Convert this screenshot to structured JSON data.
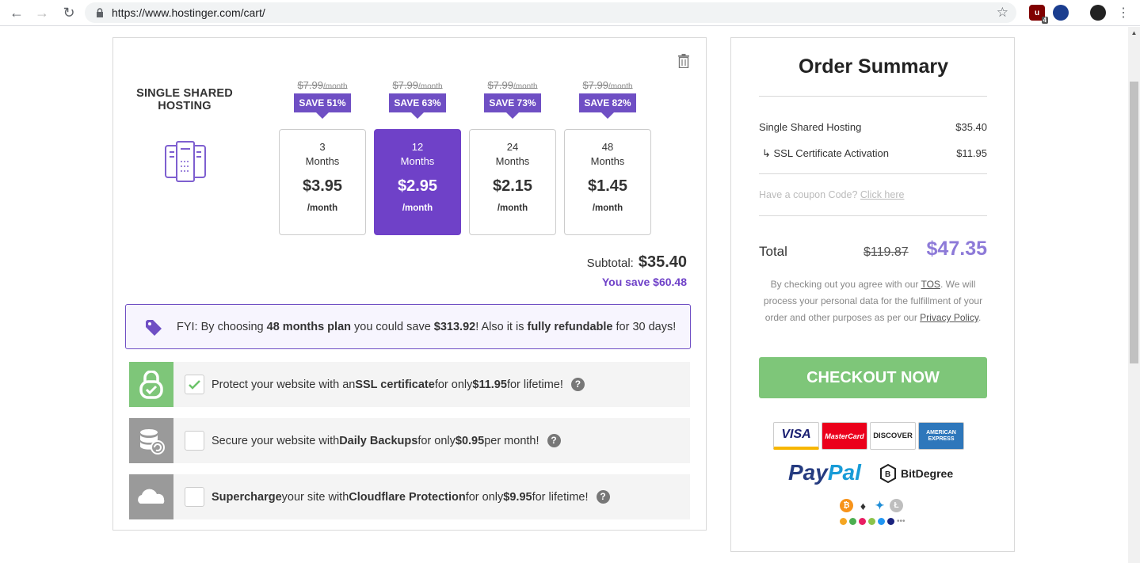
{
  "browser": {
    "url": "https://www.hostinger.com/cart/",
    "ext_badge": "4"
  },
  "product": {
    "title": "SINGLE SHARED HOSTING"
  },
  "plans": [
    {
      "old_price": "$7.99",
      "old_unit": "/month",
      "badge": "SAVE 51%",
      "months_num": "3",
      "months_label": "Months",
      "price": "$3.95",
      "per": "/month",
      "selected": false
    },
    {
      "old_price": "$7.99",
      "old_unit": "/month",
      "badge": "SAVE 63%",
      "months_num": "12",
      "months_label": "Months",
      "price": "$2.95",
      "per": "/month",
      "selected": true
    },
    {
      "old_price": "$7.99",
      "old_unit": "/month",
      "badge": "SAVE 73%",
      "months_num": "24",
      "months_label": "Months",
      "price": "$2.15",
      "per": "/month",
      "selected": false
    },
    {
      "old_price": "$7.99",
      "old_unit": "/month",
      "badge": "SAVE 82%",
      "months_num": "48",
      "months_label": "Months",
      "price": "$1.45",
      "per": "/month",
      "selected": false
    }
  ],
  "subtotal": {
    "label": "Subtotal:",
    "value": "$35.40",
    "you_save": "You save $60.48"
  },
  "fyi": {
    "prefix": "FYI: By choosing ",
    "plan": "48 months plan",
    "mid": " you could save ",
    "amount": "$313.92",
    "mid2": "! Also it is ",
    "refundable": "fully refundable",
    "suffix": " for 30 days!"
  },
  "addons": [
    {
      "checked": true,
      "pre": "Protect your website with an ",
      "bold1": "SSL certificate",
      "mid": " for only ",
      "bold2": "$11.95",
      "post": " for lifetime!",
      "side_color": "#7ec679"
    },
    {
      "checked": false,
      "pre": "Secure your website with ",
      "bold1": "Daily Backups",
      "mid": " for only ",
      "bold2": "$0.95",
      "post": " per month!",
      "side_color": "#9a9a9a"
    },
    {
      "checked": false,
      "pre": "",
      "bold1": "Supercharge",
      "mid": " your site with ",
      "bold2": "Cloudflare Protection",
      "mid2": " for only ",
      "bold3": "$9.95",
      "post": " for lifetime!",
      "side_color": "#9a9a9a"
    }
  ],
  "summary": {
    "title": "Order Summary",
    "items": [
      {
        "name": "Single Shared Hosting",
        "price": "$35.40"
      },
      {
        "name": "↳ SSL Certificate Activation",
        "price": "$11.95"
      }
    ],
    "coupon_text": "Have a coupon Code? ",
    "coupon_link": "Click here",
    "total_label": "Total",
    "total_old": "$119.87",
    "total_new": "$47.35",
    "tos_1": "By checking out you agree with our ",
    "tos_link": "TOS",
    "tos_2": ". We will process your personal data for the fulfillment of your order and other purposes as per our ",
    "privacy_link": "Privacy Policy",
    "tos_3": ".",
    "checkout_label": "CHECKOUT NOW",
    "cards": [
      "VISA",
      "MasterCard",
      "DISCOVER",
      "AMERICAN EXPRESS"
    ],
    "paypal_1": "Pay",
    "paypal_2": "Pal",
    "bitdegree": "BitDegree"
  }
}
